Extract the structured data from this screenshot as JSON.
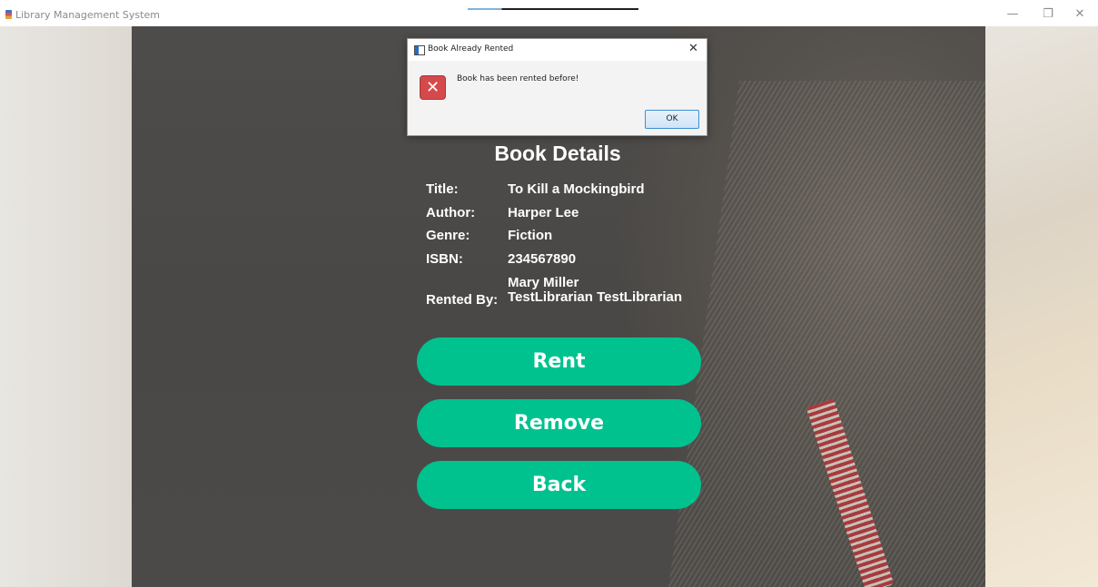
{
  "window": {
    "title": "Library Management System",
    "minimize": "—",
    "maximize": "❐",
    "close": "✕"
  },
  "details": {
    "heading": "Book Details",
    "title_label": "Title:",
    "title_value": "To Kill a Mockingbird",
    "author_label": "Author:",
    "author_value": "Harper Lee",
    "genre_label": "Genre:",
    "genre_value": "Fiction",
    "isbn_label": "ISBN:",
    "isbn_value": "234567890",
    "rented_label": "Rented By:",
    "rented_value_line1": "Mary Miller",
    "rented_value_line2": "TestLibrarian TestLibrarian"
  },
  "buttons": {
    "rent": "Rent",
    "remove": "Remove",
    "back": "Back"
  },
  "dialog": {
    "title": "Book Already Rented",
    "close": "✕",
    "error_icon": "✕",
    "message": "Book has been rented before!",
    "ok": "OK"
  },
  "colors": {
    "accent": "#00c28f",
    "error": "#d6494a"
  }
}
